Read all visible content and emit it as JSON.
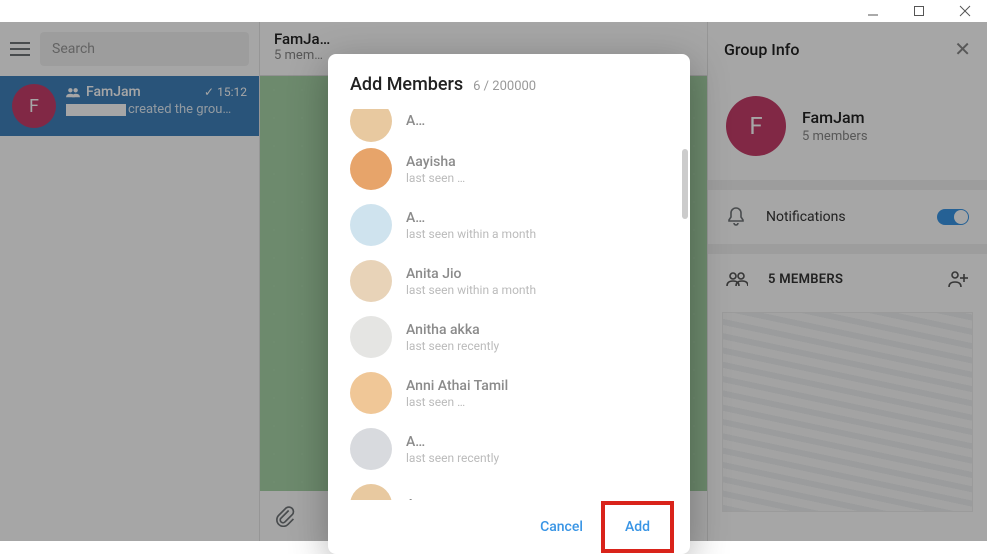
{
  "window": {
    "min": "",
    "max": "",
    "close": ""
  },
  "search": {
    "placeholder": "Search"
  },
  "chat_item": {
    "avatar_letter": "F",
    "title": "FamJam",
    "time": "15:12",
    "preview": "created the grou…"
  },
  "center": {
    "title": "FamJa…",
    "subtitle": "5 mem…"
  },
  "right": {
    "header": "Group Info",
    "avatar_letter": "F",
    "name": "FamJam",
    "members_sub": "5 members",
    "notifications_label": "Notifications",
    "members_header": "5 MEMBERS"
  },
  "modal": {
    "title": "Add Members",
    "count": "6 / 200000",
    "cancel": "Cancel",
    "add": "Add",
    "contacts": [
      {
        "name": "A…",
        "status": "",
        "color": "#e8c9a0"
      },
      {
        "name": "Aayisha",
        "status": "last seen …",
        "color": "#e7a46a"
      },
      {
        "name": "A…",
        "status": "last seen within a month",
        "color": "#cfe3ee"
      },
      {
        "name": "Anita Jio",
        "status": "last seen within a month",
        "color": "#e8d3b8"
      },
      {
        "name": "Anitha akka",
        "status": "last seen recently",
        "color": "#e5e5e3"
      },
      {
        "name": "Anni Athai Tamil",
        "status": "last seen …",
        "color": "#f0c797"
      },
      {
        "name": "A…",
        "status": "last seen recently",
        "color": "#d8dade"
      },
      {
        "name": "A…",
        "status": "",
        "color": "#e8c9a0"
      }
    ]
  }
}
